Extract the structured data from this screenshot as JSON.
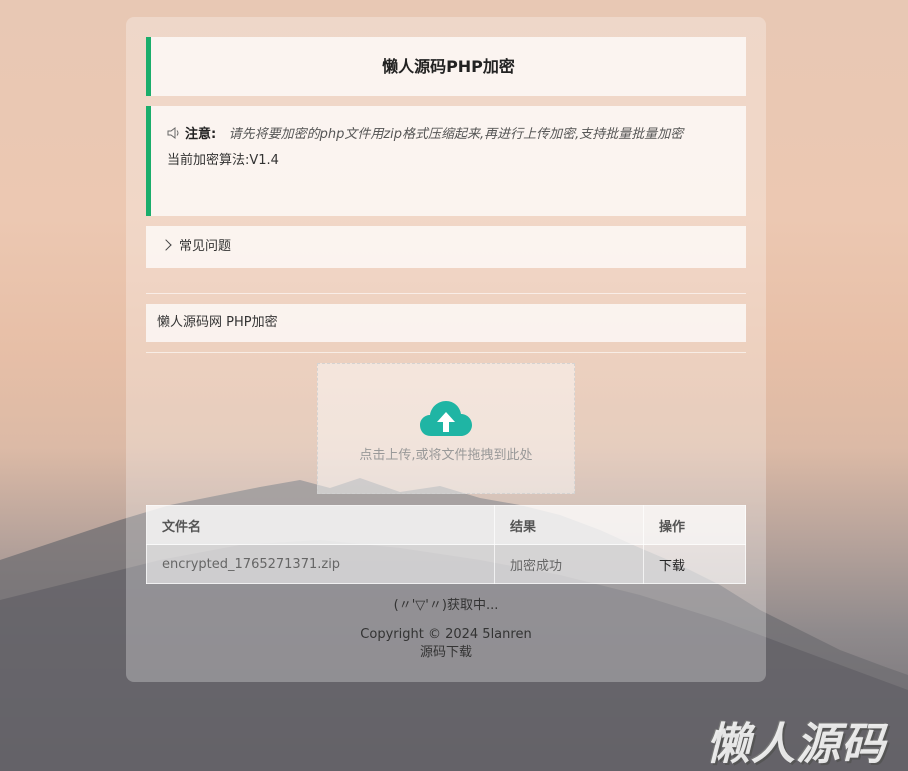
{
  "header": {
    "title": "懒人源码PHP加密"
  },
  "notice": {
    "label": "注意:",
    "text": "请先将要加密的php文件用zip格式压缩起来,再进行上传加密,支持批量批量加密",
    "algorithm": "当前加密算法:V1.4",
    "icon": "speaker-icon"
  },
  "faq": {
    "label": "常见问题",
    "icon": "chevron-right-icon"
  },
  "section": {
    "label": "懒人源码网 PHP加密"
  },
  "upload": {
    "hint": "点击上传,或将文件拖拽到此处",
    "icon": "cloud-upload-icon",
    "icon_color": "#1fb5a4"
  },
  "table": {
    "headers": [
      "文件名",
      "结果",
      "操作"
    ],
    "rows": [
      {
        "filename": "encrypted_1765271371.zip",
        "result": "加密成功",
        "action": "下载"
      }
    ]
  },
  "status": {
    "text": "(〃'▽'〃)获取中..."
  },
  "footer": {
    "copyright": "Copyright © 2024 5lanren",
    "link": "源码下载"
  },
  "watermark": {
    "text": "懒人源码"
  },
  "colors": {
    "accent": "#1aad6b"
  }
}
